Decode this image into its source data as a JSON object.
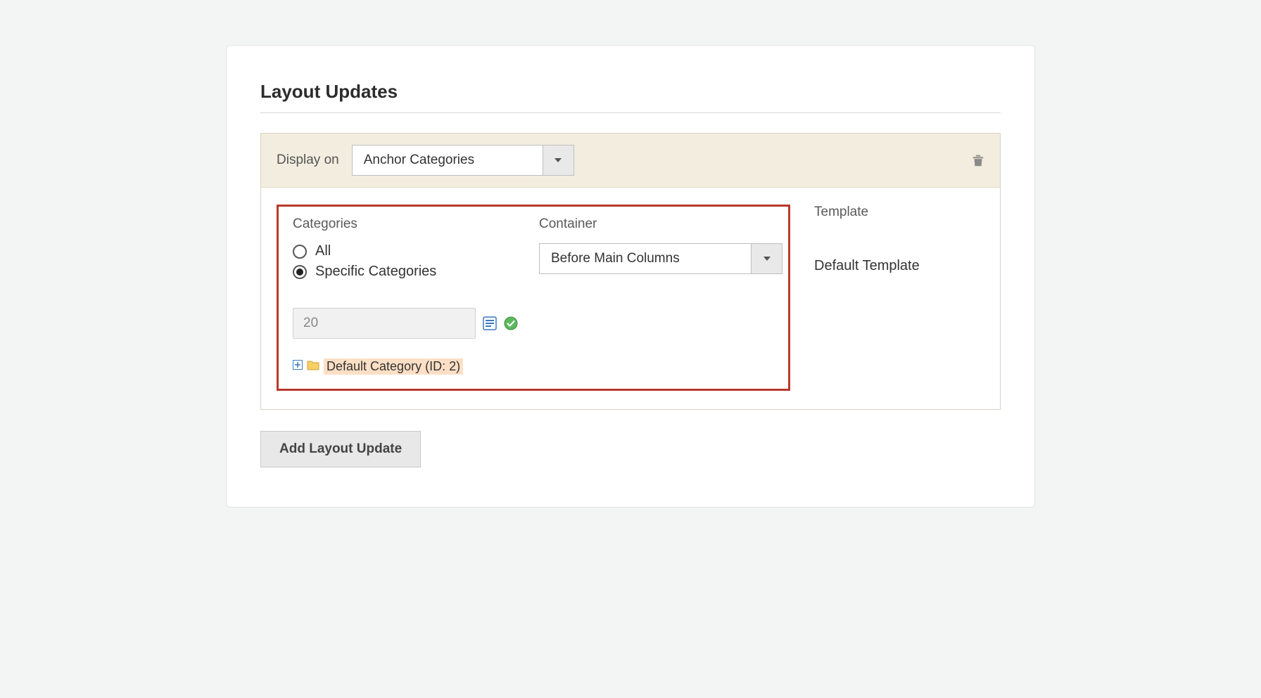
{
  "section": {
    "title": "Layout Updates"
  },
  "block": {
    "display_on_label": "Display on",
    "display_on_value": "Anchor Categories",
    "columns": {
      "categories_label": "Categories",
      "container_label": "Container",
      "template_label": "Template"
    },
    "radios": {
      "all": "All",
      "specific": "Specific Categories",
      "selected": "specific"
    },
    "id_input_value": "20",
    "tree_node_label": "Default Category (ID: 2)",
    "container_value": "Before Main Columns",
    "template_value": "Default Template"
  },
  "add_button_label": "Add Layout Update"
}
